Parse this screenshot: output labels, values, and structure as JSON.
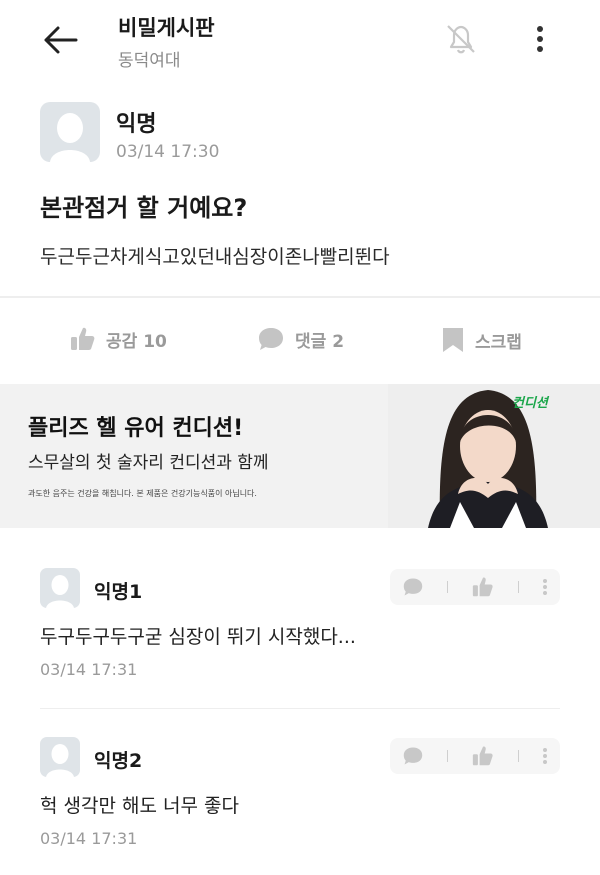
{
  "header": {
    "title": "비밀게시판",
    "subtitle": "동덕여대",
    "icons": [
      "back-arrow-icon",
      "bell-off-icon",
      "more-vertical-icon"
    ]
  },
  "post": {
    "author": "익명",
    "time": "03/14 17:30",
    "title": "본관점거 할 거예요?",
    "body": "두근두근차게식고있던내심장이존나빨리뛴다"
  },
  "actions": {
    "like_label": "공감 10",
    "comment_label": "댓글 2",
    "scrap_label": "스크랩"
  },
  "ad": {
    "title": "플리즈 헬 유어 컨디션!",
    "subtitle": "스무살의 첫 술자리 컨디션과 함께",
    "disclaimer": "과도한 음주는 건강을 해칩니다. 본 제품은 건강기능식품이 아닙니다.",
    "brand": "컨디션"
  },
  "comments": [
    {
      "author": "익명1",
      "text": "두구두구두구굳 심장이 뛰기 시작했다...",
      "time": "03/14 17:31"
    },
    {
      "author": "익명2",
      "text": "헉 생각만 해도 너무 좋다",
      "time": "03/14 17:31"
    }
  ],
  "colors": {
    "muted": "#9a9a9a",
    "avatar_bg": "#dfe4e8",
    "ad_bg": "#f2f2f2",
    "brand_green": "#1aa64a"
  }
}
